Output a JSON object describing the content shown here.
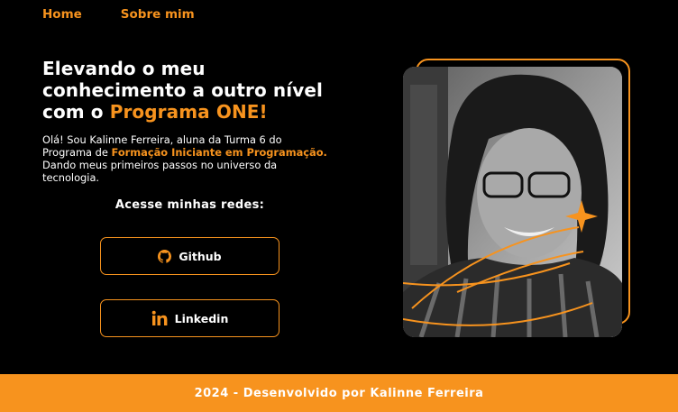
{
  "nav": {
    "home": "Home",
    "about": "Sobre mim"
  },
  "hero": {
    "line1": "Elevando o meu",
    "line2": "conhecimento a outro nível",
    "line3_prefix": "com o ",
    "line3_highlight": "Programa ONE!"
  },
  "intro": {
    "part1": "Olá! Sou Kalinne Ferreira, aluna da Turma 6 do Programa de ",
    "highlight": "Formação Iniciante em Programação.",
    "part2": " Dando meus primeiros passos no universo da tecnologia."
  },
  "social": {
    "title": "Acesse minhas redes:",
    "github_label": "Github",
    "linkedin_label": "Linkedin"
  },
  "footer": {
    "text": "2024 - Desenvolvido por Kalinne Ferreira"
  },
  "colors": {
    "accent": "#f7931e",
    "background": "#000000",
    "text": "#ffffff"
  },
  "icons": {
    "github": "github-icon",
    "linkedin": "linkedin-icon",
    "sparkle": "sparkle-icon"
  }
}
